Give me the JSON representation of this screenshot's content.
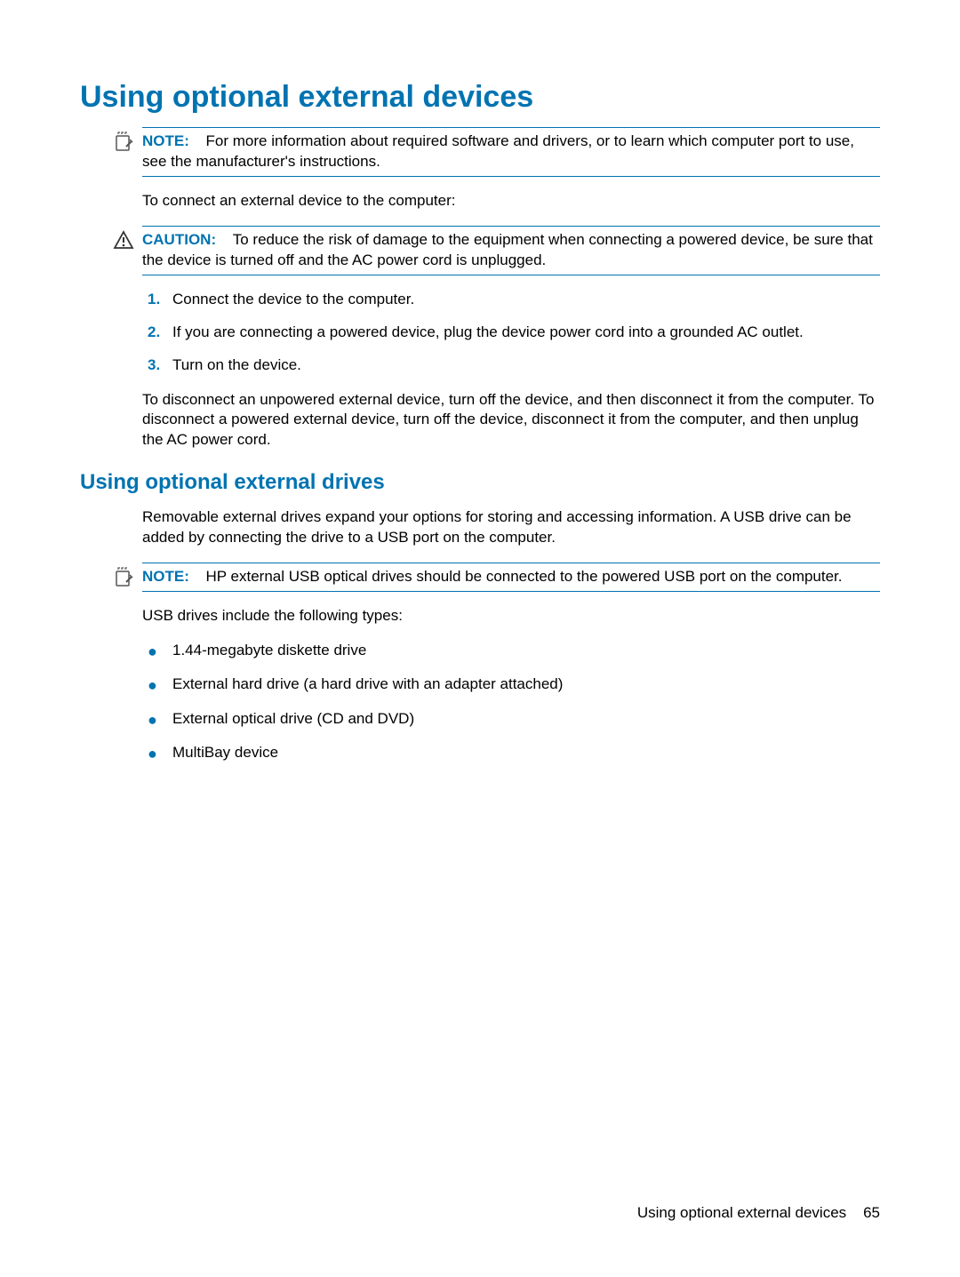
{
  "colors": {
    "accent": "#0073b1"
  },
  "heading": "Using optional external devices",
  "note1": {
    "label": "NOTE:",
    "text": "For more information about required software and drivers, or to learn which computer port to use, see the manufacturer's instructions."
  },
  "para_connect_intro": "To connect an external device to the computer:",
  "caution": {
    "label": "CAUTION:",
    "text": "To reduce the risk of damage to the equipment when connecting a powered device, be sure that the device is turned off and the AC power cord is unplugged."
  },
  "ordered": [
    {
      "num": "1.",
      "text": "Connect the device to the computer."
    },
    {
      "num": "2.",
      "text": "If you are connecting a powered device, plug the device power cord into a grounded AC outlet."
    },
    {
      "num": "3.",
      "text": "Turn on the device."
    }
  ],
  "para_disconnect": "To disconnect an unpowered external device, turn off the device, and then disconnect it from the computer. To disconnect a powered external device, turn off the device, disconnect it from the computer, and then unplug the AC power cord.",
  "subheading": "Using optional external drives",
  "para_removable": "Removable external drives expand your options for storing and accessing information. A USB drive can be added by connecting the drive to a USB port on the computer.",
  "note2": {
    "label": "NOTE:",
    "text": "HP external USB optical drives should be connected to the powered USB port on the computer."
  },
  "para_usb_types": "USB drives include the following types:",
  "bullets": [
    "1.44-megabyte diskette drive",
    "External hard drive (a hard drive with an adapter attached)",
    "External optical drive (CD and DVD)",
    "MultiBay device"
  ],
  "footer": {
    "text": "Using optional external devices",
    "page": "65"
  }
}
